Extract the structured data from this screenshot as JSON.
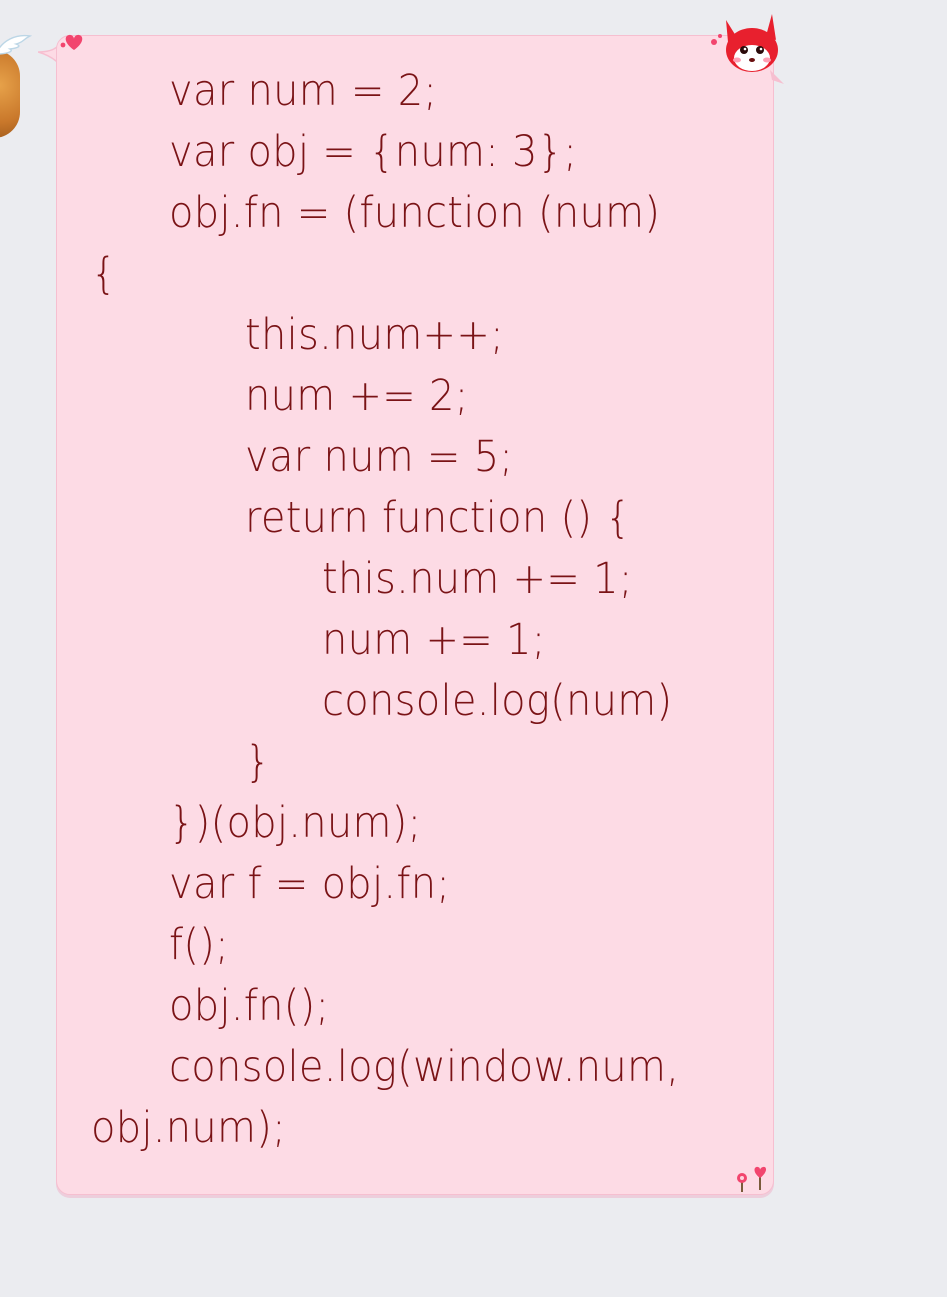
{
  "message": {
    "lines": [
      "var num = 2;",
      "var obj = {num: 3};",
      "obj.fn = (function (num)",
      "{",
      "this.num++;",
      "num += 2;",
      "var num = 5;",
      "return function () {",
      "this.num += 1;",
      "num += 1;",
      "console.log(num)",
      "}",
      "})(obj.num);",
      "var f = obj.fn;",
      "f();",
      "obj.fn();",
      "console.log(window.num,",
      "obj.num);"
    ]
  },
  "decorations": {
    "avatar": "avatar",
    "top_left": "heart-icon",
    "top_right": "red-fox-sticker-icon",
    "bottom_right": "flowers-icon"
  },
  "colors": {
    "page_background": "#ebecf0",
    "bubble_background": "#fddbe5",
    "bubble_border": "#f6bfd0",
    "text": "#7a1316"
  }
}
